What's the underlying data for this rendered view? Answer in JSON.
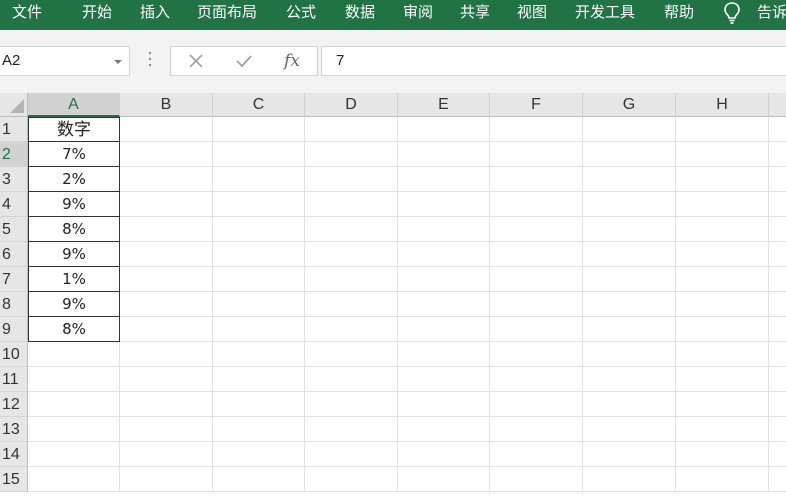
{
  "menu": {
    "items": [
      "文件",
      "开始",
      "插入",
      "页面布局",
      "公式",
      "数据",
      "审阅",
      "共享",
      "视图",
      "开发工具",
      "帮助"
    ],
    "tell_me": "告诉",
    "accent_color": "#217346"
  },
  "formula_bar": {
    "name_box": "A2",
    "cancel_icon": "close-icon",
    "enter_icon": "check-icon",
    "fx_label": "fx",
    "content": "7"
  },
  "sheet": {
    "columns": [
      "A",
      "B",
      "C",
      "D",
      "E",
      "F",
      "G",
      "H"
    ],
    "rows": [
      "1",
      "2",
      "3",
      "4",
      "5",
      "6",
      "7",
      "8",
      "9",
      "10",
      "11",
      "12",
      "13",
      "14",
      "15"
    ],
    "active_cell": "A2",
    "column_a_values": [
      "数字",
      "7%",
      "2%",
      "9%",
      "8%",
      "9%",
      "1%",
      "9%",
      "8%"
    ]
  }
}
